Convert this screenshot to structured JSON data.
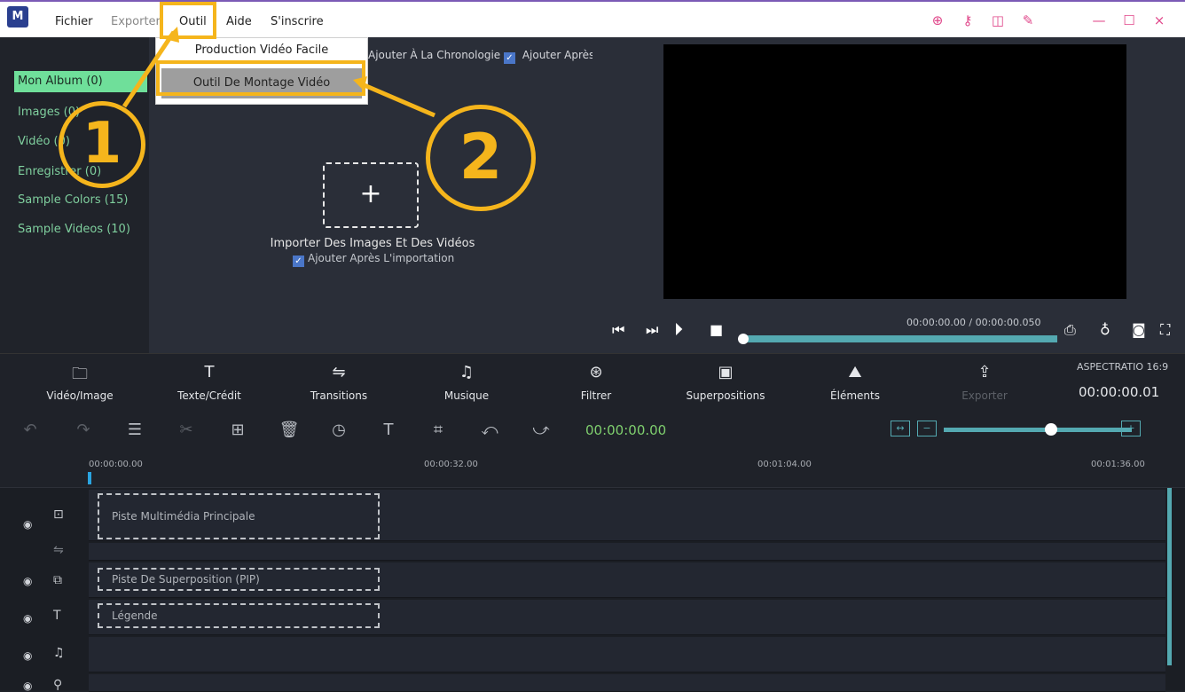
{
  "menu": {
    "logo": "M",
    "fichier": "Fichier",
    "exporter": "Exporter",
    "outil": "Outil",
    "aide": "Aide",
    "sinscrire": "S'inscrire"
  },
  "window": {
    "shop_icon": "shopping-cart-icon",
    "key_icon": "key-icon",
    "layout_icon": "layout-icon",
    "edit_icon": "edit-icon",
    "minimize": "—",
    "maximize": "☐",
    "close": "×"
  },
  "dropdown": {
    "item1": "Production Vidéo Facile",
    "item2": "Outil De Montage Vidéo"
  },
  "library": {
    "items": [
      "Mon Album (0)",
      "Images (0)",
      "Vidéo (0)",
      "Enregistrer (0)",
      "Sample Colors (15)",
      "Sample Videos (10)"
    ]
  },
  "media": {
    "top_label": "Ajouter À La Chronologie",
    "top_check": "Ajouter Après",
    "import_plus": "+",
    "import_title": "Importer Des Images Et Des Vidéos",
    "import_check": "Ajouter Après L'importation"
  },
  "player": {
    "timecode": "00:00:00.00 / 00:00:00.050",
    "progress": 0.0
  },
  "tabs": [
    {
      "icon": "🗀",
      "label": "Vidéo/Image"
    },
    {
      "icon": "T",
      "label": "Texte/Crédit"
    },
    {
      "icon": "⇋",
      "label": "Transitions"
    },
    {
      "icon": "♫",
      "label": "Musique"
    },
    {
      "icon": "⊛",
      "label": "Filtrer"
    },
    {
      "icon": "▣",
      "label": "Superpositions"
    },
    {
      "icon": "⛰",
      "label": "Éléments"
    },
    {
      "icon": "⇪",
      "label": "Exporter"
    }
  ],
  "aspect": {
    "label": "ASPECTRATIO 16:9",
    "time": "00:00:00.01"
  },
  "edit": {
    "time": "00:00:00.00"
  },
  "ruler": {
    "labels": [
      "00:00:00.00",
      "00:00:32.00",
      "00:01:04.00",
      "00:01:36.00"
    ]
  },
  "tracks": {
    "main": "Piste Multimédia Principale",
    "pip": "Piste De Superposition (PIP)",
    "caption": "Légende"
  },
  "annotations": {
    "step1": "1",
    "step2": "2"
  },
  "colors": {
    "accent": "#f5b51c",
    "active_green": "#6fdf9a",
    "teal": "#54a9b1"
  }
}
